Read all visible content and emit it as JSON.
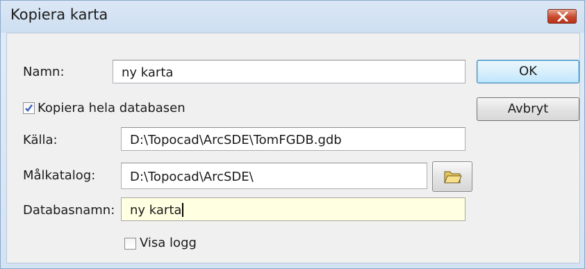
{
  "window": {
    "title": "Kopiera karta",
    "close_icon": "close-icon"
  },
  "form": {
    "name_label": "Namn:",
    "name_value": "ny karta",
    "copy_db_label": "Kopiera hela databasen",
    "copy_db_checked": true,
    "source_label": "Källa:",
    "source_value": "D:\\Topocad\\ArcSDE\\TomFGDB.gdb",
    "target_label": "Målkatalog:",
    "target_value": "D:\\Topocad\\ArcSDE\\",
    "browse_icon": "folder-icon",
    "dbname_label": "Databasnamn:",
    "dbname_value": "ny karta",
    "showlog_label": "Visa logg",
    "showlog_checked": false
  },
  "buttons": {
    "ok_label": "OK",
    "cancel_label": "Avbryt"
  },
  "colors": {
    "close_button": "#c7492e",
    "active_field": "#ffffe1",
    "check_mark": "#3a62b8"
  }
}
